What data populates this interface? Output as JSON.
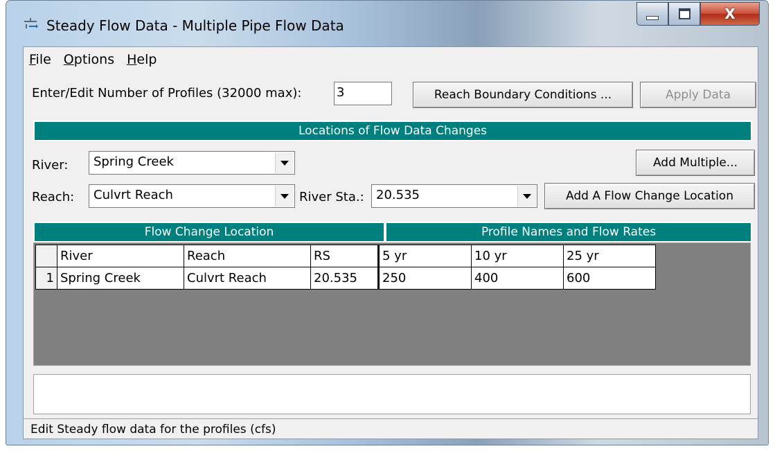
{
  "window": {
    "title": "Steady Flow Data - Multiple Pipe Flow Data",
    "close_label": "X"
  },
  "menu": [
    {
      "prefix": "",
      "underline": "F",
      "rest": "ile"
    },
    {
      "prefix": "",
      "underline": "O",
      "rest": "ptions"
    },
    {
      "prefix": "",
      "underline": "H",
      "rest": "elp"
    }
  ],
  "profiles": {
    "label": "Enter/Edit Number of Profiles (32000 max):",
    "value": "3"
  },
  "buttons": {
    "reach_boundary": "Reach Boundary Conditions ...",
    "apply_data": "Apply Data",
    "add_multiple": "Add Multiple...",
    "add_flow_change": "Add A Flow Change Location"
  },
  "locations_banner": "Locations of Flow Data Changes",
  "river": {
    "label": "River:",
    "value": "Spring Creek"
  },
  "reach": {
    "label": "Reach:",
    "value": "Culvrt Reach"
  },
  "river_sta": {
    "label": "River Sta.:",
    "value": "20.535"
  },
  "table": {
    "left_banner": "Flow Change Location",
    "right_banner": "Profile Names and Flow Rates",
    "columns": [
      "River",
      "Reach",
      "RS",
      "5 yr",
      "10 yr",
      "25 yr"
    ],
    "rows": [
      {
        "num": "1",
        "river": "Spring Creek",
        "reach": "Culvrt Reach",
        "rs": "20.535",
        "p1": "250",
        "p2": "400",
        "p3": "600"
      }
    ]
  },
  "status": "Edit Steady flow data for the profiles (cfs)",
  "colors": {
    "banner": "#007f7f",
    "grid_bg": "#808080"
  }
}
